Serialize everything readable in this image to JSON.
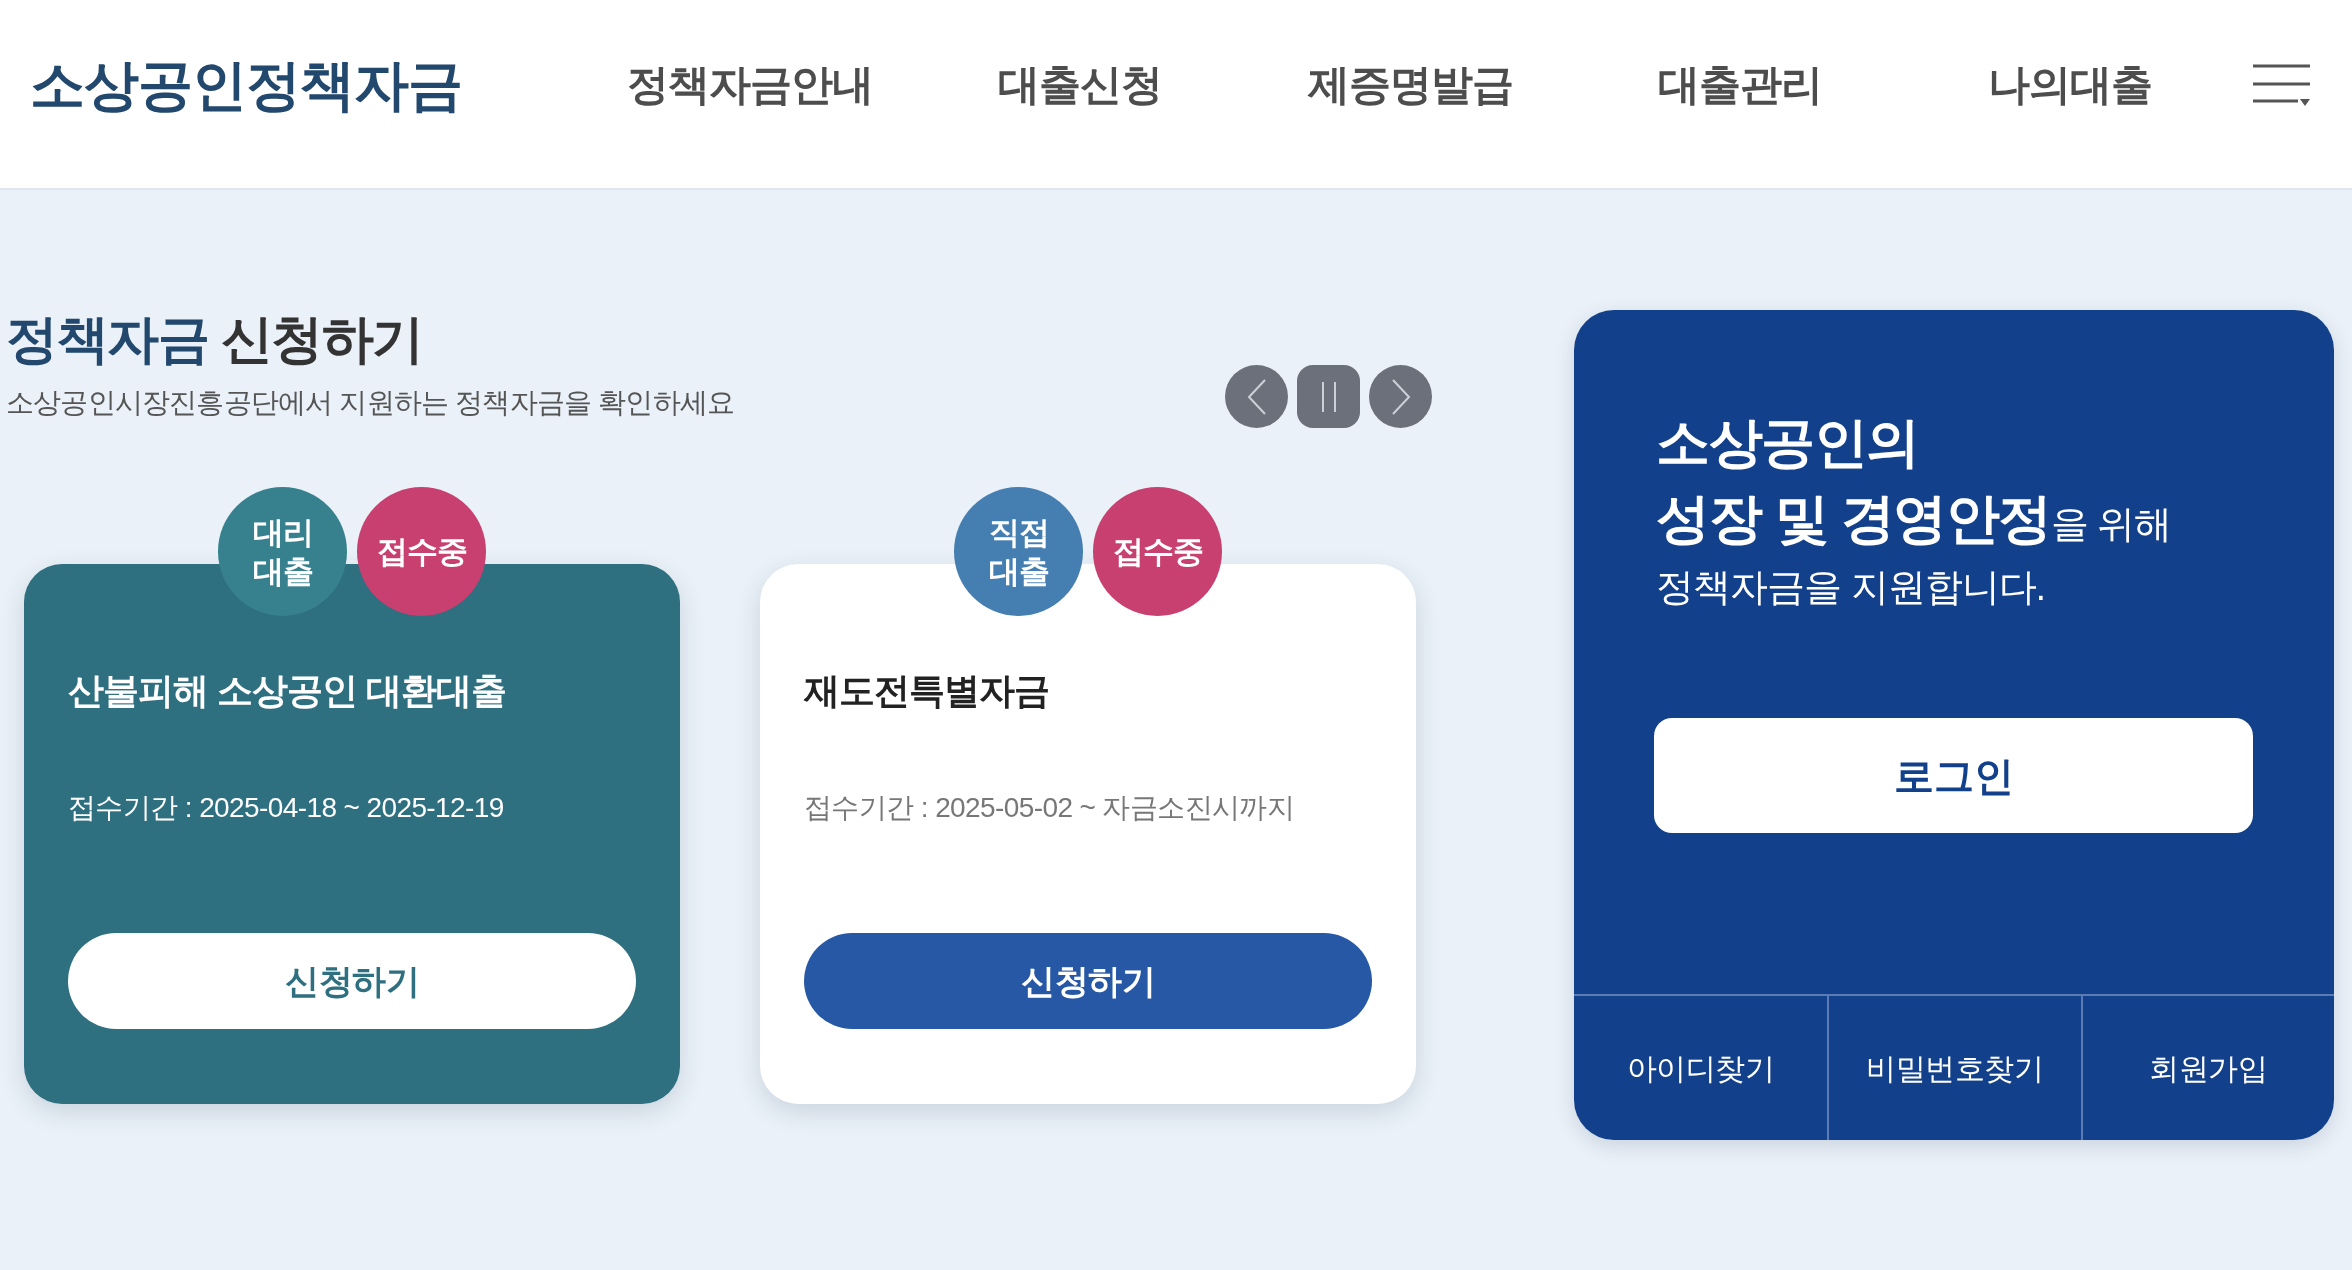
{
  "header": {
    "logo": "소상공인정책자금",
    "nav": [
      {
        "label": "정책자금안내"
      },
      {
        "label": "대출신청"
      },
      {
        "label": "제증명발급"
      },
      {
        "label": "대출관리"
      },
      {
        "label": "나의대출"
      }
    ]
  },
  "section": {
    "title": {
      "accent": "정책자금",
      "text": "신청하기"
    },
    "subtitle": "소상공인시장진흥공단에서 지원하는 정책자금을 확인하세요"
  },
  "cards": [
    {
      "selected": true,
      "badges": [
        {
          "label": "대리 대출",
          "color": "#37818f"
        },
        {
          "label": "접수중",
          "color": "#c8406f"
        }
      ],
      "title": "산불피해 소상공인 대환대출",
      "period": "접수기간 : 2025-04-18 ~ 2025-12-19",
      "button": "신청하기"
    },
    {
      "selected": false,
      "badges": [
        {
          "label": "직접 대출",
          "color": "#457eb0"
        },
        {
          "label": "접수중",
          "color": "#c8406f"
        }
      ],
      "title": "재도전특별자금",
      "period": "접수기간 : 2025-05-02 ~ 자금소진시까지",
      "button": "신청하기"
    }
  ],
  "login_panel": {
    "headline": [
      "**소상공인의**",
      "**성장 및 경영안정**을 위해",
      "정책자금을 지원합니다."
    ],
    "login_button": "로그인",
    "links": [
      "아이디찾기",
      "비밀번호찾기",
      "회원가입"
    ]
  }
}
